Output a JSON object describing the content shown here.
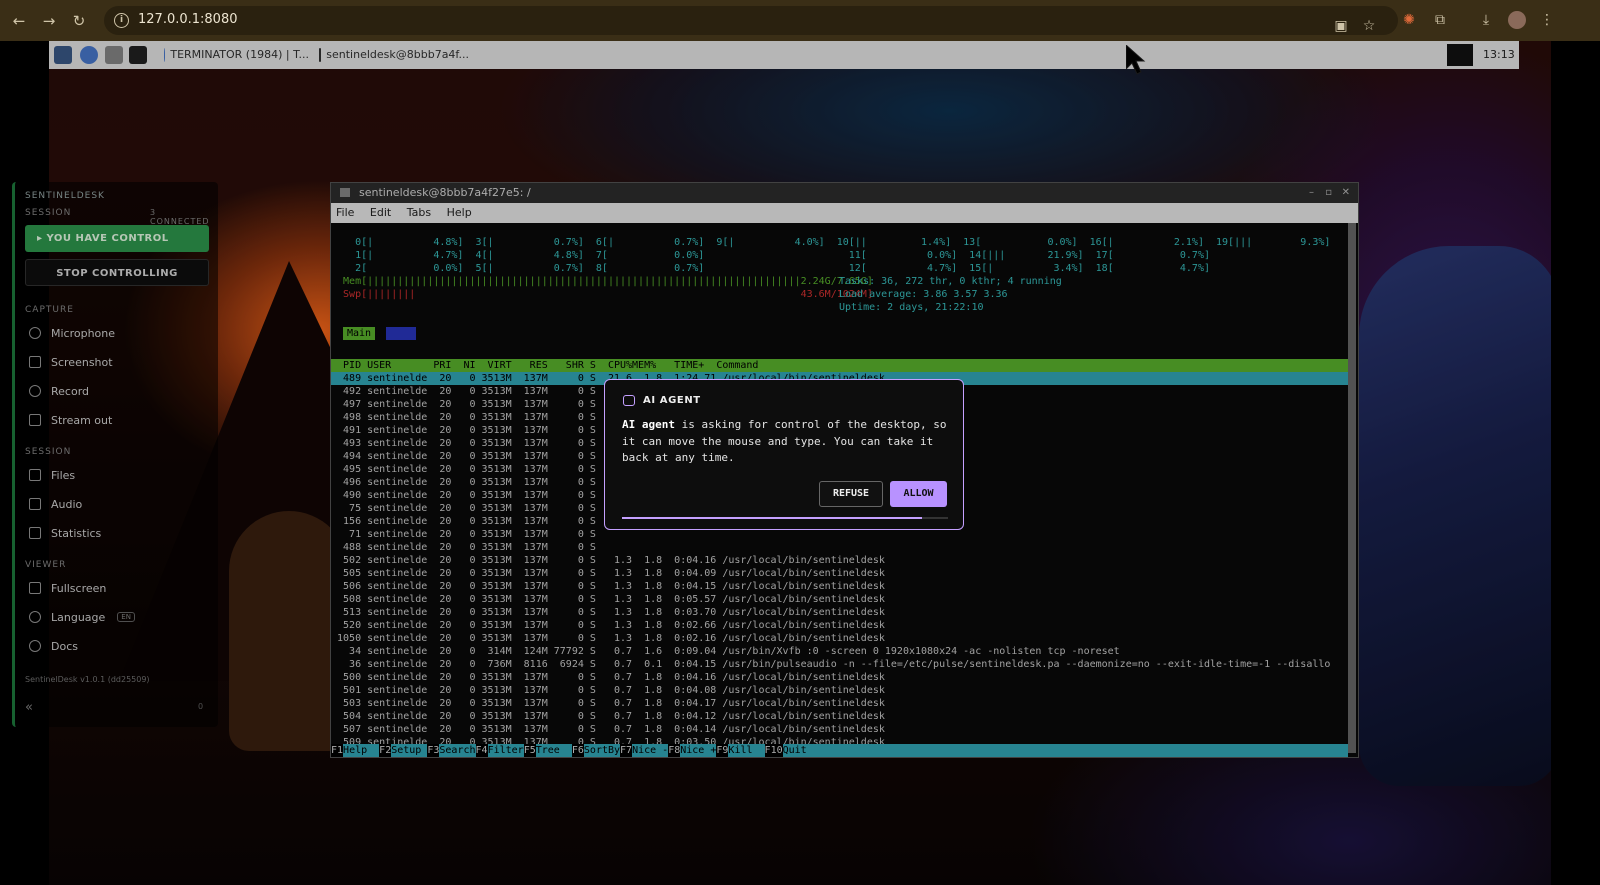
{
  "browser": {
    "url": "127.0.0.1:8080",
    "nav_icons": [
      "back-icon",
      "forward-icon",
      "reload-icon"
    ],
    "right_icons": [
      "clipboard-icon",
      "star-icon",
      "extension-puzzle-icon",
      "download-icon",
      "profile-avatar",
      "more-menu-icon"
    ]
  },
  "taskbar": {
    "apps": [
      "show-desktop-icon",
      "chromium-icon",
      "file-manager-icon",
      "terminal-icon"
    ],
    "windows": [
      "TERMINATOR (1984) | T...",
      "sentineldesk@8bbb7a4f..."
    ],
    "clock": "13:13"
  },
  "terminal": {
    "title": "sentineldesk@8bbb7a4f27e5: /",
    "menu": [
      "File",
      "Edit",
      "Tabs",
      "Help"
    ],
    "cpu_lines": [
      "    0[|          4.8%]  3[|          0.7%]  6[|          0.7%]  9[|          4.0%]  10[||         1.4%]  13[           0.0%]  16[|          2.1%]  19[|||        9.3%]",
      "    1[|          4.7%]  4[|          4.8%]  7[           0.0%]                        11[          0.0%]  14[|||       21.9%]  17[           0.7%]",
      "    2[           0.0%]  5[|          0.7%]  8[           0.7%]                        12[          4.7%]  15[|          3.4%]  18[           4.7%]"
    ],
    "mem_line": "  Mem[||||||||||||||||||||||||||||||||||||||||||||||||||||||||||||||||||||||||2.24G/7.65G]",
    "swp_line": "  Swp[||||||||                                                                43.6M/1024M]",
    "tasks_line": "Tasks: 36, 272 thr, 0 kthr; 4 running",
    "load_line": "Load average: 3.86 3.57 3.36",
    "uptime_line": "Uptime: 2 days, 21:22:10",
    "tab_main": "Main",
    "header": "  PID USER       PRI  NI  VIRT   RES   SHR S  CPU%MEM%   TIME+  Command",
    "rows": [
      "  489 sentinelde  20   0 3513M  137M     0 S  21.6  1.8  1:24.71 /usr/local/bin/sentineldesk",
      "  492 sentinelde  20   0 3513M  137M     0 S   5.4  1.8  0:20.85 /usr/local/bin/sentineldesk",
      "  497 sentinelde  20   0 3513M  137M     0 S",
      "  498 sentinelde  20   0 3513M  137M     0 S",
      "  491 sentinelde  20   0 3513M  137M     0 S",
      "  493 sentinelde  20   0 3513M  137M     0 S",
      "  494 sentinelde  20   0 3513M  137M     0 S",
      "  495 sentinelde  20   0 3513M  137M     0 S",
      "  496 sentinelde  20   0 3513M  137M     0 S",
      "  490 sentinelde  20   0 3513M  137M     0 S",
      "   75 sentinelde  20   0 3513M  137M     0 S",
      "  156 sentinelde  20   0 3513M  137M     0 S",
      "   71 sentinelde  20   0 3513M  137M     0 S",
      "  488 sentinelde  20   0 3513M  137M     0 S",
      "  502 sentinelde  20   0 3513M  137M     0 S   1.3  1.8  0:04.16 /usr/local/bin/sentineldesk",
      "  505 sentinelde  20   0 3513M  137M     0 S   1.3  1.8  0:04.09 /usr/local/bin/sentineldesk",
      "  506 sentinelde  20   0 3513M  137M     0 S   1.3  1.8  0:04.15 /usr/local/bin/sentineldesk",
      "  508 sentinelde  20   0 3513M  137M     0 S   1.3  1.8  0:05.57 /usr/local/bin/sentineldesk",
      "  513 sentinelde  20   0 3513M  137M     0 S   1.3  1.8  0:03.70 /usr/local/bin/sentineldesk",
      "  520 sentinelde  20   0 3513M  137M     0 S   1.3  1.8  0:02.66 /usr/local/bin/sentineldesk",
      " 1050 sentinelde  20   0 3513M  137M     0 S   1.3  1.8  0:02.16 /usr/local/bin/sentineldesk",
      "   34 sentinelde  20   0  314M  124M 77792 S   0.7  1.6  0:09.04 /usr/bin/Xvfb :0 -screen 0 1920x1080x24 -ac -nolisten tcp -noreset",
      "   36 sentinelde  20   0  736M  8116  6924 S   0.7  0.1  0:04.15 /usr/bin/pulseaudio -n --file=/etc/pulse/sentineldesk.pa --daemonize=no --exit-idle-time=-1 --disallo",
      "  500 sentinelde  20   0 3513M  137M     0 S   0.7  1.8  0:04.16 /usr/local/bin/sentineldesk",
      "  501 sentinelde  20   0 3513M  137M     0 S   0.7  1.8  0:04.08 /usr/local/bin/sentineldesk",
      "  503 sentinelde  20   0 3513M  137M     0 S   0.7  1.8  0:04.17 /usr/local/bin/sentineldesk",
      "  504 sentinelde  20   0 3513M  137M     0 S   0.7  1.8  0:04.12 /usr/local/bin/sentineldesk",
      "  507 sentinelde  20   0 3513M  137M     0 S   0.7  1.8  0:04.14 /usr/local/bin/sentineldesk",
      "  509 sentinelde  20   0 3513M  137M     0 S   0.7  1.8  0:03.50 /usr/local/bin/sentineldesk",
      "  510 sentinelde  20   0 3513M  137M     0 S   0.7  1.8  0:02.79 /usr/local/bin/sentineldesk"
    ],
    "fkeys": [
      {
        "key": "F1",
        "label": "Help  "
      },
      {
        "key": "F2",
        "label": "Setup "
      },
      {
        "key": "F3",
        "label": "Search"
      },
      {
        "key": "F4",
        "label": "Filter"
      },
      {
        "key": "F5",
        "label": "Tree  "
      },
      {
        "key": "F6",
        "label": "SortBy"
      },
      {
        "key": "F7",
        "label": "Nice -"
      },
      {
        "key": "F8",
        "label": "Nice +"
      },
      {
        "key": "F9",
        "label": "Kill  "
      },
      {
        "key": "F10",
        "label": "Quit  "
      }
    ]
  },
  "sidebar": {
    "brand": "SENTINELDESK",
    "session_caption": "SESSION",
    "connected": "3 CONNECTED",
    "control_label": "YOU HAVE CONTROL",
    "stop_label": "STOP CONTROLLING",
    "capture_caption": "CAPTURE",
    "capture_items": [
      "Microphone",
      "Screenshot",
      "Record",
      "Stream out"
    ],
    "session2_caption": "SESSION",
    "session_items": [
      "Files",
      "Audio",
      "Statistics"
    ],
    "viewer_caption": "VIEWER",
    "viewer_items": [
      "Fullscreen",
      "Language",
      "Docs"
    ],
    "language_badge": "EN",
    "version": "SentinelDesk v1.0.1 (dd25509)",
    "collapse": "«",
    "count": "0"
  },
  "dialog": {
    "title": "AI AGENT",
    "message_bold": "AI agent",
    "message_rest": " is asking for control of the desktop, so it can move the mouse and type. You can take it back at any time.",
    "refuse": "REFUSE",
    "allow": "ALLOW",
    "countdown_fraction": 0.92,
    "accent": "#c4a0ff"
  },
  "colors": {
    "accent_green": "#1e7d3e",
    "htop_cyan": "#33aaba",
    "htop_green": "#5bb52d"
  }
}
